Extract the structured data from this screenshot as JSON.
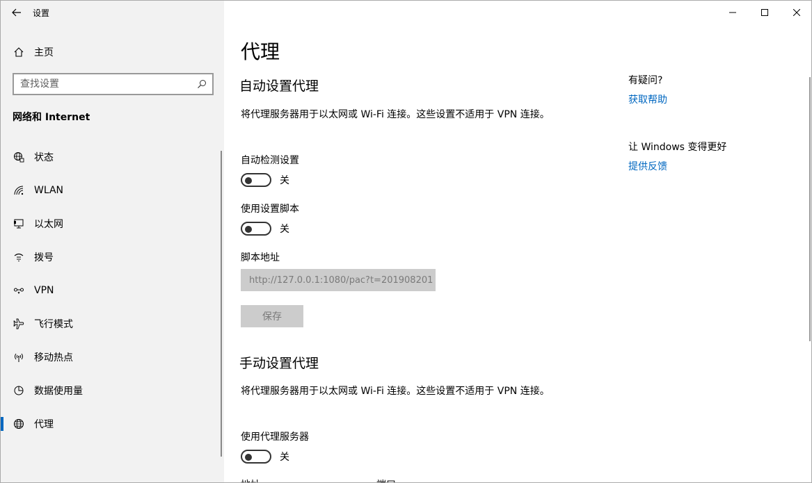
{
  "window": {
    "title": "设置"
  },
  "sidebar": {
    "home_label": "主页",
    "search_placeholder": "查找设置",
    "section_title": "网络和 Internet",
    "items": [
      {
        "label": "状态",
        "icon": "globe-status-icon"
      },
      {
        "label": "WLAN",
        "icon": "wifi-icon"
      },
      {
        "label": "以太网",
        "icon": "ethernet-icon"
      },
      {
        "label": "拨号",
        "icon": "dialup-icon"
      },
      {
        "label": "VPN",
        "icon": "vpn-icon"
      },
      {
        "label": "飞行模式",
        "icon": "airplane-icon"
      },
      {
        "label": "移动热点",
        "icon": "hotspot-icon"
      },
      {
        "label": "数据使用量",
        "icon": "data-usage-icon"
      },
      {
        "label": "代理",
        "icon": "globe-icon",
        "active": true
      }
    ]
  },
  "main": {
    "title": "代理",
    "auto": {
      "heading": "自动设置代理",
      "desc": "将代理服务器用于以太网或 Wi-Fi 连接。这些设置不适用于 VPN 连接。",
      "detect_label": "自动检测设置",
      "detect_state": "关",
      "script_label": "使用设置脚本",
      "script_state": "关",
      "address_label": "脚本地址",
      "address_value": "http://127.0.0.1:1080/pac?t=201908201",
      "save_label": "保存"
    },
    "manual": {
      "heading": "手动设置代理",
      "desc": "将代理服务器用于以太网或 Wi-Fi 连接。这些设置不适用于 VPN 连接。",
      "use_label": "使用代理服务器",
      "use_state": "关",
      "address_label": "地址",
      "port_label": "端口"
    }
  },
  "aside": {
    "question": "有疑问?",
    "help_link": "获取帮助",
    "feedback_title": "让 Windows 变得更好",
    "feedback_link": "提供反馈"
  },
  "colors": {
    "accent": "#0067c0",
    "sidebar_bg": "#f2f2f2",
    "disabled_bg": "#cccccc"
  }
}
